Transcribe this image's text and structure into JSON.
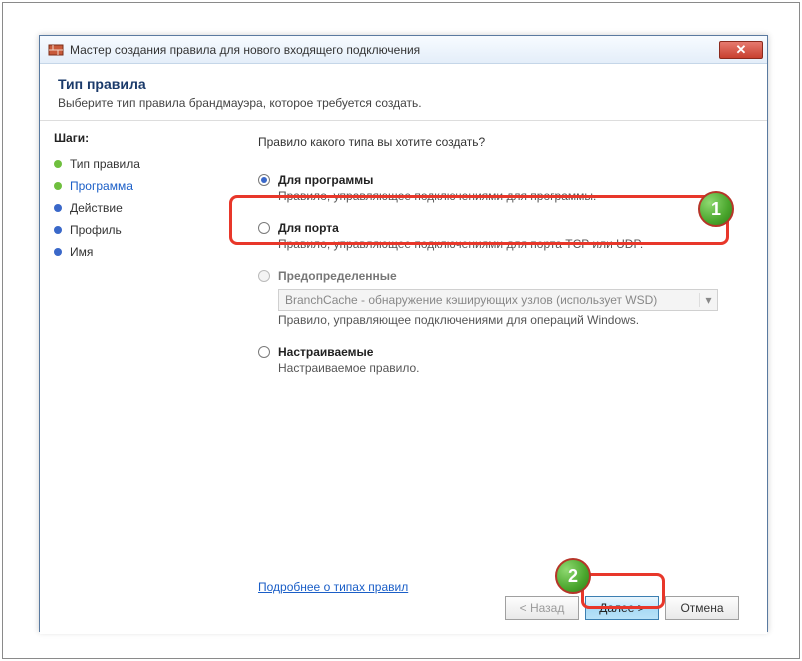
{
  "window": {
    "title": "Мастер создания правила для нового входящего подключения"
  },
  "header": {
    "title": "Тип правила",
    "subtitle": "Выберите тип правила брандмауэра, которое требуется создать."
  },
  "sidebar": {
    "stepsLabel": "Шаги:",
    "steps": [
      {
        "label": "Тип правила",
        "bullet": "green",
        "current": false
      },
      {
        "label": "Программа",
        "bullet": "green",
        "current": true
      },
      {
        "label": "Действие",
        "bullet": "blue",
        "current": false
      },
      {
        "label": "Профиль",
        "bullet": "blue",
        "current": false
      },
      {
        "label": "Имя",
        "bullet": "blue",
        "current": false
      }
    ]
  },
  "main": {
    "question": "Правило какого типа вы хотите создать?",
    "options": [
      {
        "key": "program",
        "title": "Для программы",
        "desc": "Правило, управляющее подключениями для программы.",
        "checked": true
      },
      {
        "key": "port",
        "title": "Для порта",
        "desc": "Правило, управляющее подключениями для порта TCP или UDP.",
        "checked": false
      },
      {
        "key": "predefined",
        "title": "Предопределенные",
        "desc": "Правило, управляющее подключениями для операций Windows.",
        "checked": false,
        "dropdown": "BranchCache - обнаружение кэширующих узлов (использует WSD)"
      },
      {
        "key": "custom",
        "title": "Настраиваемые",
        "desc": "Настраиваемое правило.",
        "checked": false
      }
    ],
    "learnMore": "Подробнее о типах правил"
  },
  "buttons": {
    "back": "< Назад",
    "next": "Далее >",
    "cancel": "Отмена"
  },
  "annotations": {
    "badge1": "1",
    "badge2": "2"
  }
}
